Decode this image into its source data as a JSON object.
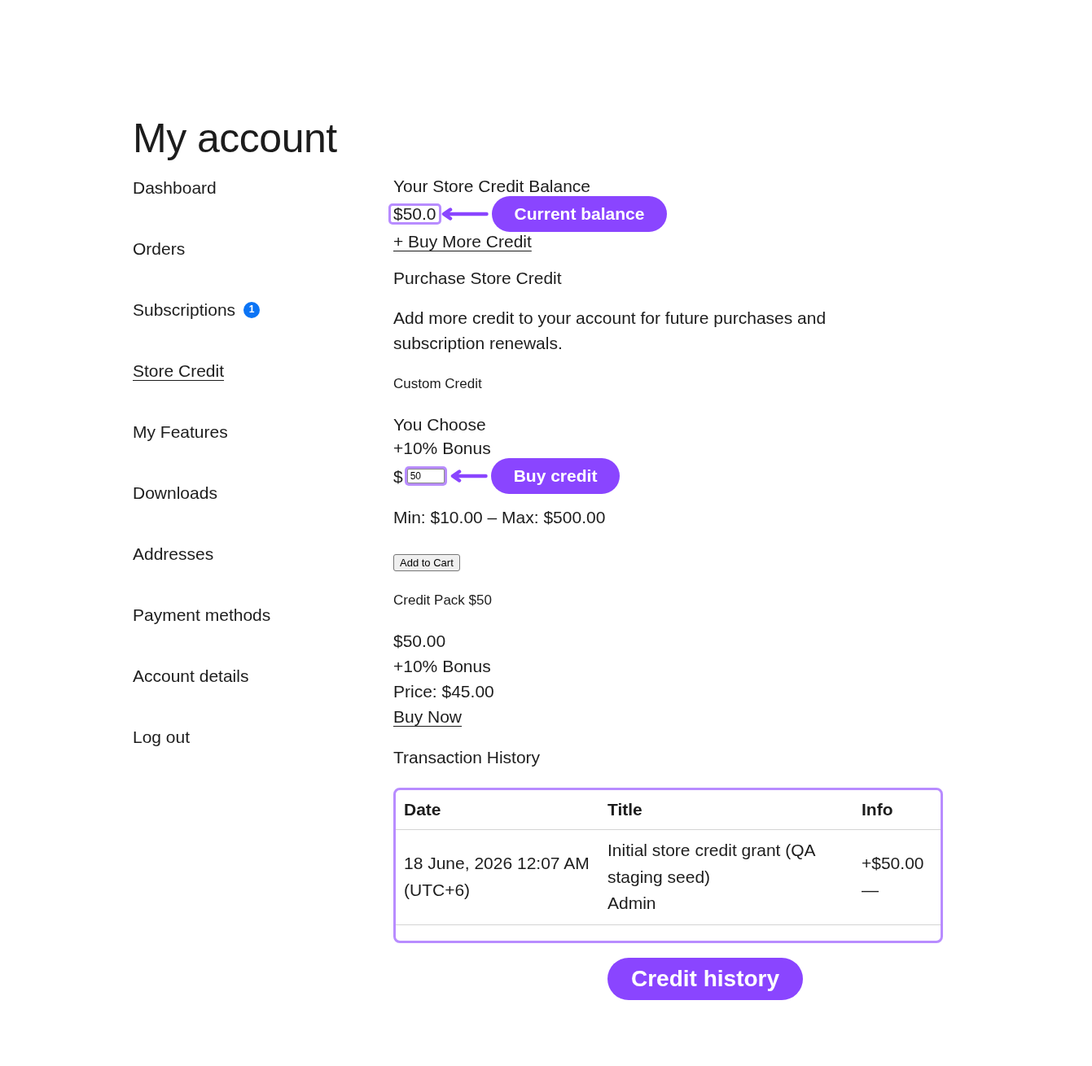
{
  "page": {
    "title": "My account"
  },
  "sidebar": {
    "items": [
      {
        "label": "Dashboard",
        "selected": false
      },
      {
        "label": "Orders",
        "selected": false
      },
      {
        "label": "Subscriptions",
        "selected": false,
        "badge": "1"
      },
      {
        "label": "Store Credit",
        "selected": true
      },
      {
        "label": "My Features",
        "selected": false
      },
      {
        "label": "Downloads",
        "selected": false
      },
      {
        "label": "Addresses",
        "selected": false
      },
      {
        "label": "Payment methods",
        "selected": false
      },
      {
        "label": "Account details",
        "selected": false
      },
      {
        "label": "Log out",
        "selected": false
      }
    ]
  },
  "balance": {
    "label": "Your Store Credit Balance",
    "amount": "$50.0",
    "link": "+ Buy More Credit",
    "callout": "Current balance"
  },
  "purchase": {
    "heading": "Purchase Store Credit",
    "description": "Add more credit to your account for future purchases and subscription renewals.",
    "custom": {
      "title": "Custom Credit",
      "name": "You Choose",
      "bonus": "+10% Bonus",
      "currency_symbol": "$",
      "value": "50",
      "range": "Min: $10.00 – Max: $500.00",
      "button": "Add to Cart",
      "callout": "Buy credit"
    },
    "pack": {
      "title": "Credit Pack $50",
      "amount": "$50.00",
      "bonus": "+10% Bonus",
      "price": "Price: $45.00",
      "link": "Buy Now"
    }
  },
  "history": {
    "heading": "Transaction History",
    "columns": [
      "Date",
      "Title",
      "Info"
    ],
    "rows": [
      {
        "date": "18 June, 2026 12:07 AM (UTC+6)",
        "title": "Initial store credit grant (QA staging seed)",
        "author": "Admin",
        "amount": "+$50.00",
        "note": "—"
      }
    ],
    "callout": "Credit history"
  }
}
